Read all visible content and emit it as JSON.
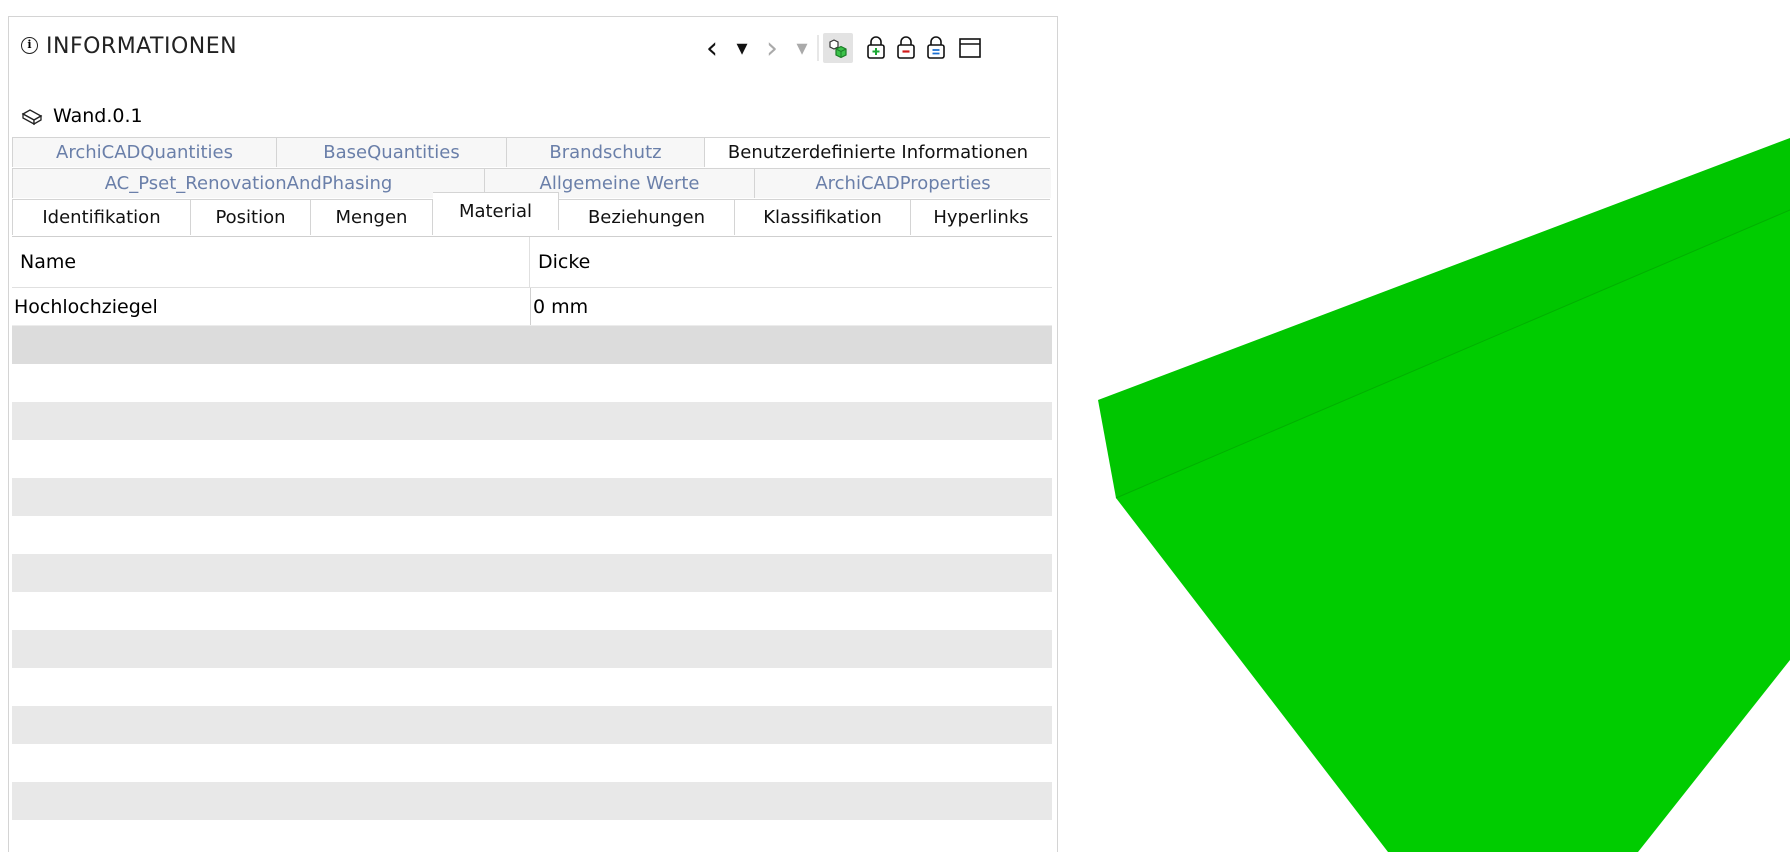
{
  "panel": {
    "title": "INFORMATIONEN",
    "info_icon": "i",
    "object_name": "Wand.0.1"
  },
  "toolbar": {
    "back": "‹",
    "back_menu": "▾",
    "forward": "›",
    "forward_menu": "▾"
  },
  "tabs": {
    "row1": [
      "ArchiCADQuantities",
      "BaseQuantities",
      "Brandschutz",
      "Benutzerdefinierte Informationen"
    ],
    "row2": [
      "AC_Pset_RenovationAndPhasing",
      "Allgemeine Werte",
      "ArchiCADProperties"
    ],
    "row3": [
      "Identifikation",
      "Position",
      "Mengen",
      "Material",
      "Beziehungen",
      "Klassifikation",
      "Hyperlinks"
    ],
    "selected": "Material"
  },
  "table": {
    "columns": [
      "Name",
      "Dicke"
    ],
    "rows": [
      [
        "Hochlochziegel",
        "0 mm"
      ]
    ]
  },
  "colors": {
    "wall_top": "#00d100",
    "wall_side": "#00c800",
    "tab_inactive_text": "#6a7fa9",
    "stripe": "#e8e8e8"
  }
}
